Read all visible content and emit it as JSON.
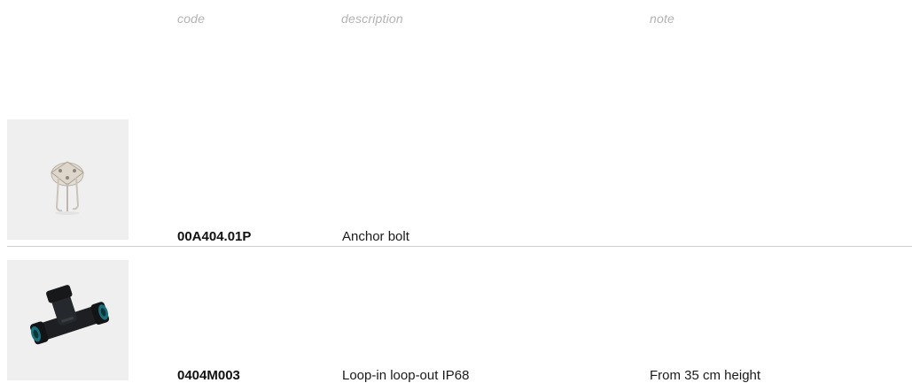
{
  "table": {
    "columns": [
      "code",
      "description",
      "note"
    ],
    "rows": [
      {
        "code": "00A404.01P",
        "description": "Anchor bolt",
        "note": "",
        "image": "anchor-bolt-image"
      },
      {
        "code": "0404M003",
        "description": "Loop-in loop-out IP68",
        "note": "From 35 cm height",
        "image": "connector-image"
      }
    ]
  }
}
